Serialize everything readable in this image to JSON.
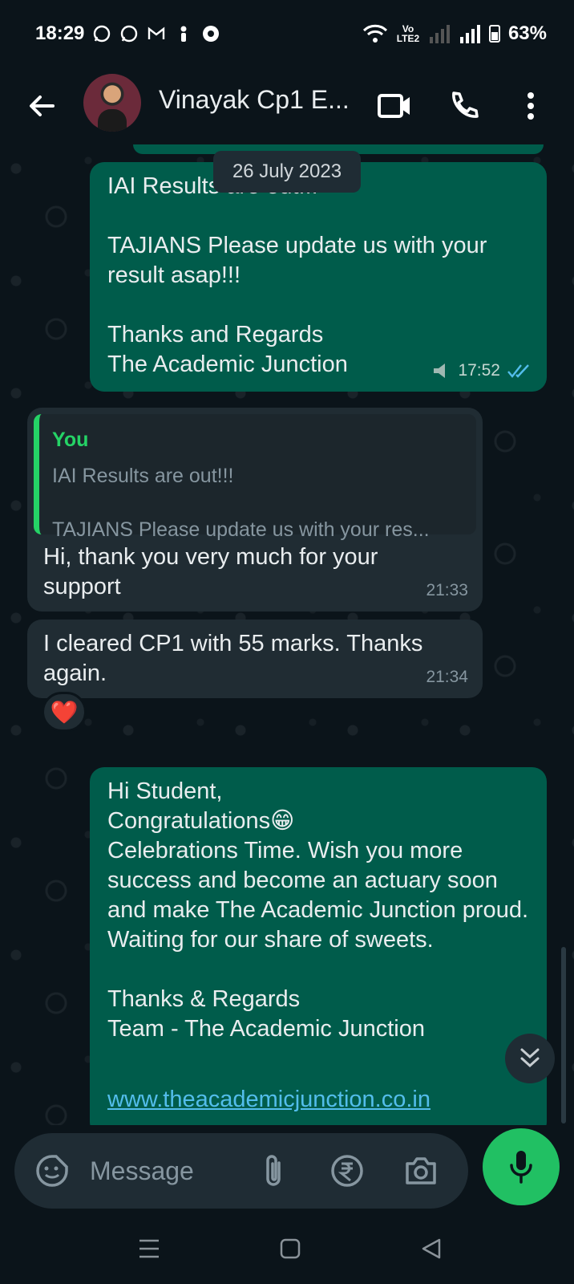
{
  "status_bar": {
    "time": "18:29",
    "network_label": "Vo LTE2",
    "battery": "63%"
  },
  "header": {
    "contact_name": "Vinayak Cp1 E...",
    "icons": [
      "back-arrow-icon",
      "video-call-icon",
      "voice-call-icon",
      "more-options-icon"
    ]
  },
  "chat": {
    "date_chip": "26 July 2023",
    "messages": [
      {
        "direction": "outgoing",
        "text": "IAI Results are out!!!\n\nTAJIANS Please update us with your result asap!!!\n\nThanks and Regards\nThe Academic Junction",
        "time": "17:52",
        "status": "read"
      },
      {
        "direction": "incoming",
        "quote": {
          "author": "You",
          "line1": "IAI Results are out!!!",
          "line2": "TAJIANS Please update us with your res..."
        },
        "text": "Hi, thank you very much for your support",
        "time": "21:33"
      },
      {
        "direction": "incoming",
        "text": "I cleared CP1 with 55 marks. Thanks again.",
        "time": "21:34",
        "reaction": "❤️"
      },
      {
        "direction": "outgoing",
        "text": "Hi Student,\nCongratulations😁\nCelebrations Time. Wish you more success and become an actuary soon and make The Academic Junction proud.\nWaiting for our share of sweets.\n\nThanks & Regards\nTeam - The Academic Junction",
        "link": "www.theacademicjunction.co.in"
      }
    ]
  },
  "composer": {
    "placeholder": "Message"
  },
  "colors": {
    "background": "#0b141a",
    "outgoing_bubble": "#005c4b",
    "incoming_bubble": "#202c33",
    "accent_green": "#25d366",
    "read_ticks": "#53bdeb"
  }
}
